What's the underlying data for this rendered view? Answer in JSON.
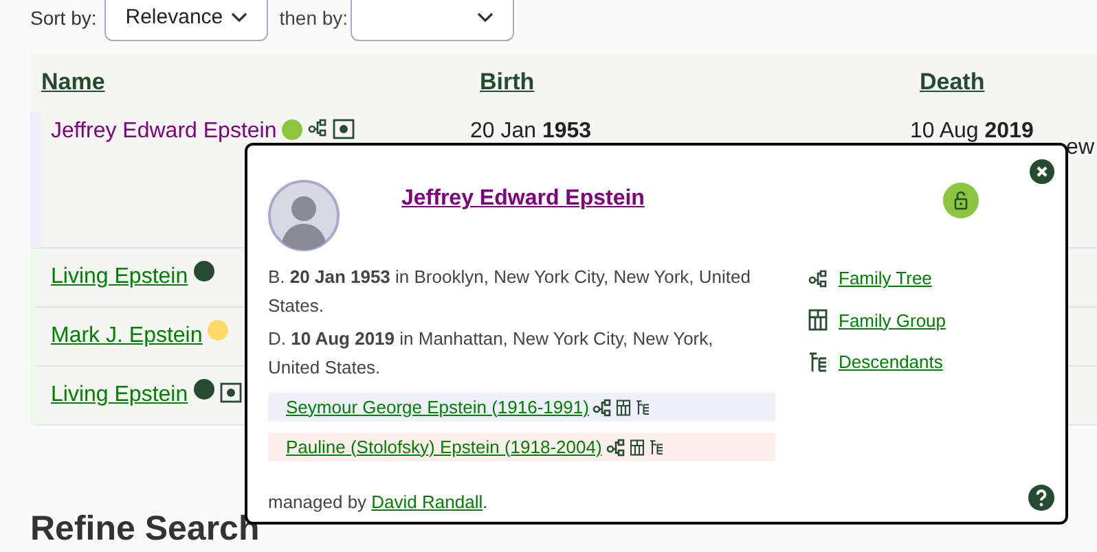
{
  "sort": {
    "label": "Sort by:",
    "value": "Relevance",
    "then_label": "then by:"
  },
  "table": {
    "columns": [
      "Name",
      "Birth",
      "Death"
    ],
    "rows": [
      {
        "name": "Jeffrey Edward Epstein",
        "kind": "featured",
        "color": "#8cc63f",
        "icons": [
          {
            "kind": "tree"
          },
          {
            "kind": "profile"
          }
        ],
        "birth": "20 Jan **1953**",
        "death": "10 Aug **2019**",
        "death_place": "ew"
      },
      {
        "name": "Living Epstein",
        "kind": "relative",
        "color": "#264b30",
        "icons": []
      },
      {
        "name": "Mark J. Epstein",
        "kind": "relative",
        "color": "#ffd966",
        "icons": []
      },
      {
        "name": "Living Epstein",
        "kind": "relative",
        "color": "#264b30",
        "icons": [
          {
            "kind": "profile"
          }
        ]
      }
    ]
  },
  "popup": {
    "name": "Jeffrey Edward Epstein",
    "birth": "B. **20 Jan 1953** in Brooklyn, New York City, New York, United States.",
    "death": "D. **10 Aug 2019** in Manhattan, New York City, New York, United States.",
    "parents": [
      {
        "name": "Seymour George Epstein (1916-1991)",
        "kind": "father"
      },
      {
        "name": "Pauline (Stolofsky) Epstein (1918-2004)",
        "kind": "mother"
      }
    ],
    "links": [
      {
        "label": "Family Tree",
        "kind": "tree"
      },
      {
        "label": "Family Group",
        "kind": "group"
      },
      {
        "label": "Descendants",
        "kind": "descendants"
      }
    ],
    "managed_prefix": "managed by",
    "manager": "David Randall",
    "managed_suffix": "."
  },
  "heading": "Refine Search"
}
